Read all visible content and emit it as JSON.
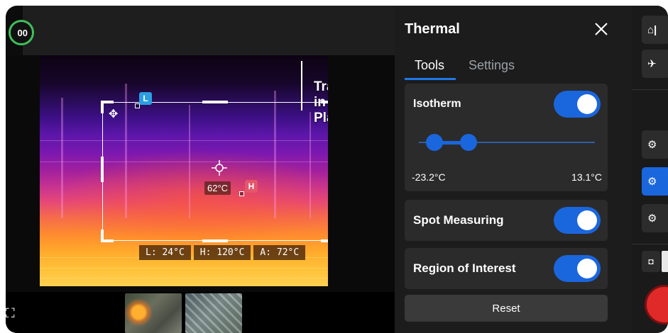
{
  "status": {
    "battery_text": "00"
  },
  "view": {
    "track_label": "Track in Place",
    "marker_low": "L",
    "marker_high": "H",
    "spot_temp": "62°C",
    "stats": {
      "low": "L: 24°C",
      "high": "H: 120°C",
      "avg": "A: 72°C"
    }
  },
  "panel": {
    "title": "Thermal",
    "tabs": [
      {
        "label": "Tools",
        "active": true
      },
      {
        "label": "Settings",
        "active": false
      }
    ],
    "isotherm": {
      "label": "Isotherm",
      "enabled": true,
      "min_label": "-23.2°C",
      "max_label": "13.1°C",
      "slider_low_fraction": 0.1,
      "slider_high_fraction": 0.3
    },
    "spot_measuring": {
      "label": "Spot Measuring",
      "enabled": true
    },
    "region_of_interest": {
      "label": "Region of Interest",
      "enabled": true
    },
    "reset_label": "Reset"
  },
  "rail": {
    "buttons": [
      "home-icon",
      "drone-icon",
      "settings-gear-icon",
      "settings-gear-active-icon",
      "settings-gear-alt-icon"
    ],
    "active_index": 3
  },
  "colors": {
    "accent": "#1a66dd",
    "record": "#e02a2a",
    "battery_ring": "#3fbf5a"
  }
}
